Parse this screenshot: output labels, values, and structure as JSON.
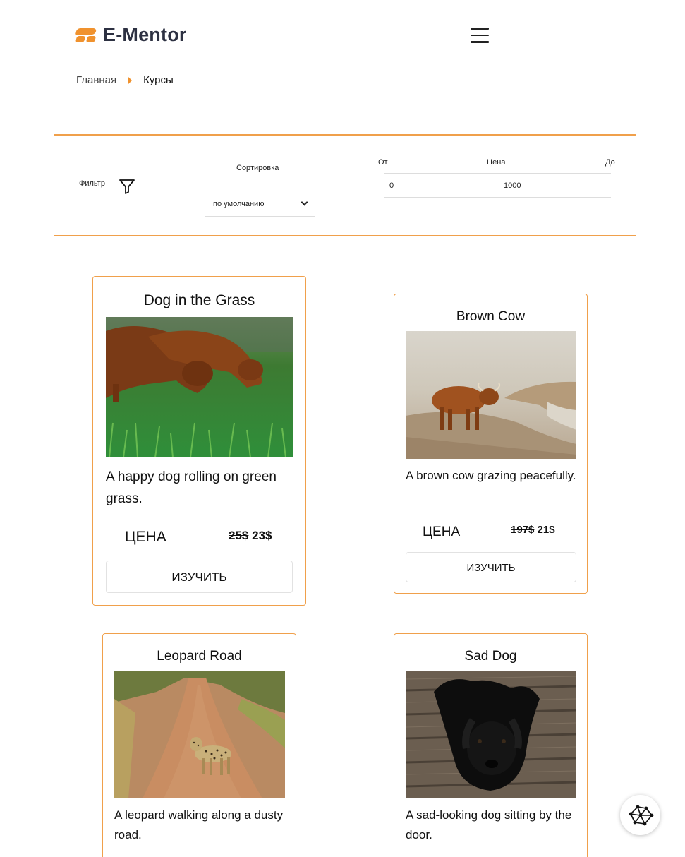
{
  "header": {
    "logo_text": "E-Mentor",
    "menu_icon": "hamburger-menu-icon"
  },
  "breadcrumb": {
    "home": "Главная",
    "current": "Курсы"
  },
  "filters": {
    "filter_label": "Фильтр",
    "filter_icon": "funnel-icon",
    "sort_label": "Сортировка",
    "sort_selected": "по умолчанию",
    "price_from_label": "От",
    "price_label": "Цена",
    "price_to_label": "До",
    "price_min": "0",
    "price_max": "1000"
  },
  "accent_color": "#f0922e",
  "courses": [
    {
      "title": "Dog in the Grass",
      "description": "A happy dog rolling on green grass.",
      "price_label": "ЦЕНА",
      "old_price": "25$",
      "new_price": "23$",
      "button_label": "ИЗУЧИТЬ"
    },
    {
      "title": "Brown Cow",
      "description": "A brown cow grazing peacefully.",
      "price_label": "ЦЕНА",
      "old_price": "197$",
      "new_price": "21$",
      "button_label": "ИЗУЧИТЬ"
    },
    {
      "title": "Leopard Road",
      "description": "A leopard walking along a dusty road."
    },
    {
      "title": "Sad Dog",
      "description": "A sad-looking dog sitting by the door."
    }
  ],
  "chat_widget_icon": "network-graph-icon"
}
